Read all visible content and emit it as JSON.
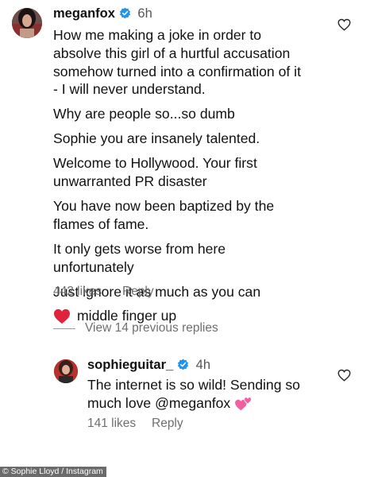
{
  "comment": {
    "username": "meganfox",
    "time": "6h",
    "lines": [
      "How me making a joke in order to",
      "absolve this girl of a hurtful accusation",
      "somehow turned into a confirmation of it",
      "- I will never understand.",
      "Why are people so...so dumb",
      "Sophie you are insanely talented.",
      "Welcome to Hollywood. Your first",
      "unwarranted PR disaster",
      "You have now been baptized by the",
      "flames of fame.",
      "It only gets worse from here",
      "unfortunately",
      "Just ignore it as much as you can",
      "middle finger up"
    ],
    "emoji_icon": "red-heart-emoji",
    "likes": "442 likes",
    "reply_label": "Reply"
  },
  "view_replies_label": "View 14 previous replies",
  "reply": {
    "username": "sophieguitar_",
    "time": "4h",
    "lines": [
      "The internet is so wild! Sending so",
      "much love @meganfox"
    ],
    "emoji_icon": "two-hearts-emoji",
    "likes": "141 likes",
    "reply_label": "Reply"
  },
  "credit": "© Sophie Lloyd / Instagram",
  "colors": {
    "verified": "#1e95f1",
    "heart_emoji": "#e0233a",
    "two_hearts_emoji": "#f25fa3",
    "meta_text": "#6f6f6f"
  }
}
